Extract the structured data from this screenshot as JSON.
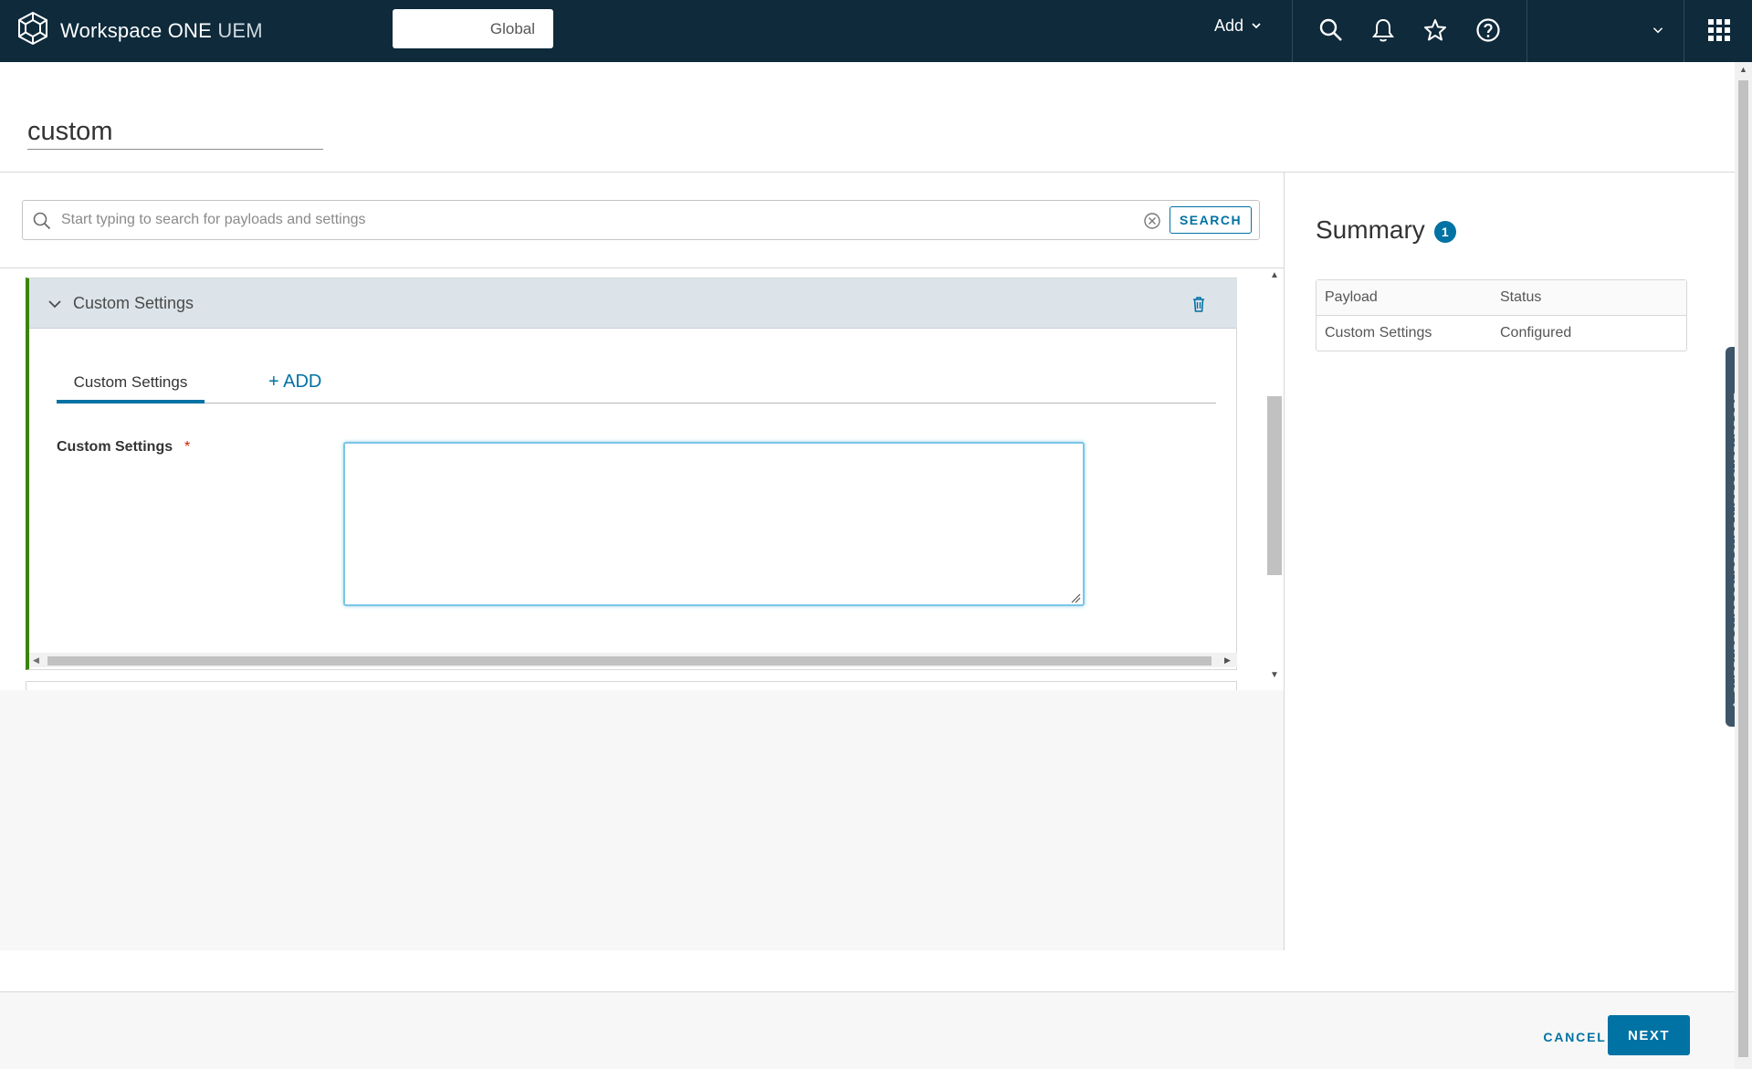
{
  "header": {
    "app_name": "Workspace ONE",
    "app_suffix": "UEM",
    "org_group": "Global",
    "add_label": "Add"
  },
  "profile": {
    "name": "custom"
  },
  "search": {
    "placeholder": "Start typing to search for payloads and settings",
    "button_label": "SEARCH"
  },
  "payload": {
    "title": "Custom Settings",
    "tabs": [
      {
        "label": "Custom Settings",
        "active": true
      },
      {
        "label": "+ ADD",
        "active": false
      }
    ],
    "field_label": "Custom Settings",
    "required_mark": "*",
    "field_value": ""
  },
  "summary": {
    "title": "Summary",
    "count": "1",
    "columns": [
      "Payload",
      "Status"
    ],
    "rows": [
      {
        "payload": "Custom Settings",
        "status": "Configured"
      }
    ]
  },
  "support": {
    "label": "SUPPUPPGUPPCSUPPGUPPJUPPCSUPPUPPORT"
  },
  "footer": {
    "cancel_label": "CANCEL",
    "next_label": "NEXT"
  },
  "colors": {
    "header_bg": "#0e2a3b",
    "accent": "#0072a3",
    "payload_border": "#3c8500",
    "required": "#c92100"
  }
}
